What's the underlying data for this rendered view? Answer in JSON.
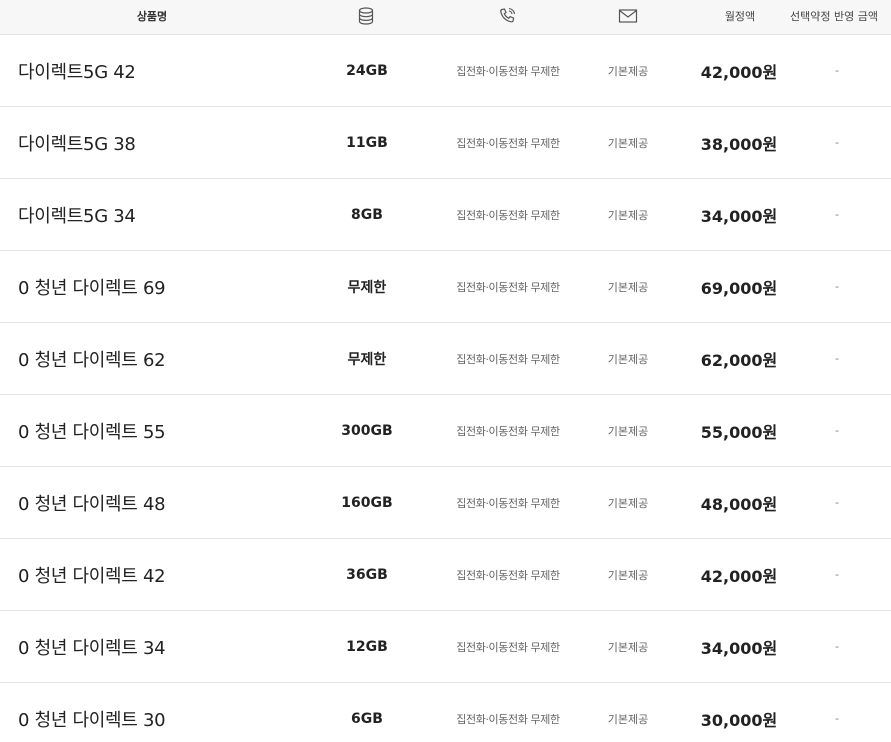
{
  "header": {
    "product_name": "상품명",
    "monthly_fee": "월정액",
    "discount": "선택약정 반영 금액",
    "icons": {
      "data": "database-icon",
      "call": "phone-icon",
      "sms": "envelope-icon"
    }
  },
  "plans": [
    {
      "name": "다이렉트5G 42",
      "data": "24GB",
      "call": "집전화·이동전화 무제한",
      "sms": "기본제공",
      "price": "42,000원",
      "discount": "-"
    },
    {
      "name": "다이렉트5G 38",
      "data": "11GB",
      "call": "집전화·이동전화 무제한",
      "sms": "기본제공",
      "price": "38,000원",
      "discount": "-"
    },
    {
      "name": "다이렉트5G 34",
      "data": "8GB",
      "call": "집전화·이동전화 무제한",
      "sms": "기본제공",
      "price": "34,000원",
      "discount": "-"
    },
    {
      "name": "0 청년 다이렉트 69",
      "data": "무제한",
      "call": "집전화·이동전화 무제한",
      "sms": "기본제공",
      "price": "69,000원",
      "discount": "-"
    },
    {
      "name": "0 청년 다이렉트 62",
      "data": "무제한",
      "call": "집전화·이동전화 무제한",
      "sms": "기본제공",
      "price": "62,000원",
      "discount": "-"
    },
    {
      "name": "0 청년 다이렉트 55",
      "data": "300GB",
      "call": "집전화·이동전화 무제한",
      "sms": "기본제공",
      "price": "55,000원",
      "discount": "-"
    },
    {
      "name": "0 청년 다이렉트 48",
      "data": "160GB",
      "call": "집전화·이동전화 무제한",
      "sms": "기본제공",
      "price": "48,000원",
      "discount": "-"
    },
    {
      "name": "0 청년 다이렉트 42",
      "data": "36GB",
      "call": "집전화·이동전화 무제한",
      "sms": "기본제공",
      "price": "42,000원",
      "discount": "-"
    },
    {
      "name": "0 청년 다이렉트 34",
      "data": "12GB",
      "call": "집전화·이동전화 무제한",
      "sms": "기본제공",
      "price": "34,000원",
      "discount": "-"
    },
    {
      "name": "0 청년 다이렉트 30",
      "data": "6GB",
      "call": "집전화·이동전화 무제한",
      "sms": "기본제공",
      "price": "30,000원",
      "discount": "-"
    }
  ]
}
